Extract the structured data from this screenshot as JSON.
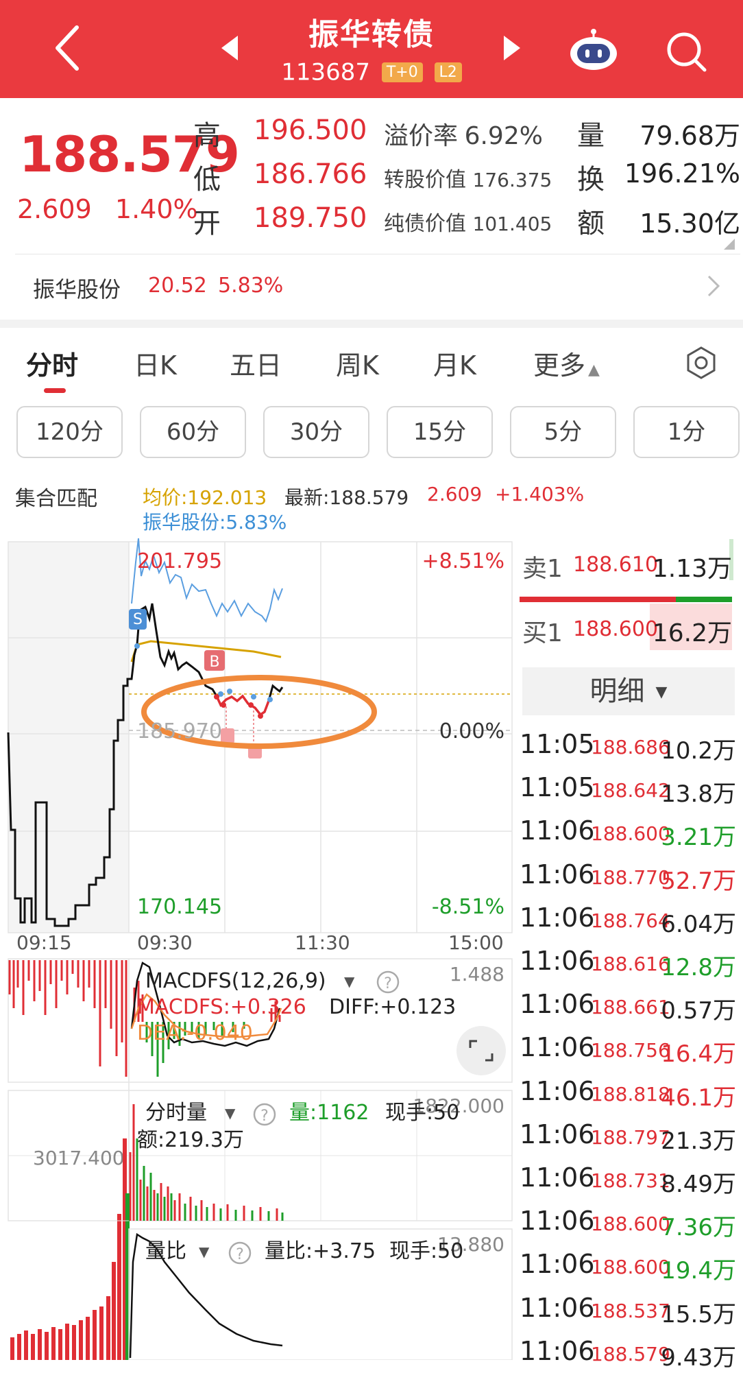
{
  "header": {
    "title": "振华转债",
    "code": "113687",
    "tags": [
      "T+0",
      "L2"
    ]
  },
  "quote": {
    "price": "188.579",
    "change": "2.609",
    "change_pct": "1.40%",
    "labels": {
      "high": "高",
      "low": "低",
      "open": "开"
    },
    "high": "196.500",
    "low": "186.766",
    "open": "189.750",
    "premium_label": "溢价率",
    "premium": "6.92%",
    "conv_value_label": "转股价值",
    "conv_value": "176.375",
    "bond_value_label": "纯债价值",
    "bond_value": "101.405",
    "right_labels": {
      "volume": "量",
      "turnover": "换",
      "amount": "额"
    },
    "volume": "79.68万",
    "turnover": "196.21%",
    "amount": "15.30亿"
  },
  "stock": {
    "name": "振华股份",
    "price": "20.52",
    "pct": "5.83%"
  },
  "tabs": [
    "分时",
    "日K",
    "五日",
    "周K",
    "月K",
    "更多"
  ],
  "periods": [
    "120分",
    "60分",
    "30分",
    "15分",
    "5分",
    "1分"
  ],
  "infobar": {
    "auction": "集合匹配",
    "avg": "均价:192.013",
    "latest": "最新:188.579",
    "chg": "2.609",
    "pct": "+1.403%",
    "stock": "振华股份:5.83%"
  },
  "main_chart": {
    "high_price": "201.795",
    "high_pct": "+8.51%",
    "base_price": "185.970",
    "base_pct": "0.00%",
    "low_price": "170.145",
    "low_pct": "-8.51%",
    "time_labels": [
      "09:15",
      "09:30",
      "11:30",
      "15:00"
    ],
    "marker_s": "S",
    "marker_b": "B"
  },
  "macd": {
    "title": "MACDFS(12,26,9)",
    "max": "1.488",
    "macdfs": "MACDFS:+0.326",
    "diff": "DIFF:+0.123",
    "dea": "DEA:-0.040"
  },
  "volume_panel": {
    "title": "分时量",
    "vol": "量:1162",
    "hand": "现手:50",
    "max": "1822.000",
    "amount": "额:219.3万",
    "left_val": "3017.400"
  },
  "ratio_panel": {
    "title": "量比",
    "ratio": "量比:+3.75",
    "hand": "现手:50",
    "max": "13.880"
  },
  "orderbook": {
    "sell_label": "卖1",
    "sell_price": "188.610",
    "sell_qty": "1.13万",
    "buy_label": "买1",
    "buy_price": "188.600",
    "buy_qty": "16.2万",
    "detail": "明细"
  },
  "trades": [
    {
      "time": "11:05",
      "price": "188.686",
      "qty": "10.2万",
      "dir": "neutral"
    },
    {
      "time": "11:05",
      "price": "188.642",
      "qty": "13.8万",
      "dir": "neutral"
    },
    {
      "time": "11:06",
      "price": "188.600",
      "qty": "3.21万",
      "dir": "sell"
    },
    {
      "time": "11:06",
      "price": "188.770",
      "qty": "52.7万",
      "dir": "buy"
    },
    {
      "time": "11:06",
      "price": "188.764",
      "qty": "6.04万",
      "dir": "neutral"
    },
    {
      "time": "11:06",
      "price": "188.616",
      "qty": "12.8万",
      "dir": "sell"
    },
    {
      "time": "11:06",
      "price": "188.661",
      "qty": "0.57万",
      "dir": "neutral"
    },
    {
      "time": "11:06",
      "price": "188.756",
      "qty": "16.4万",
      "dir": "buy"
    },
    {
      "time": "11:06",
      "price": "188.818",
      "qty": "46.1万",
      "dir": "buy"
    },
    {
      "time": "11:06",
      "price": "188.797",
      "qty": "21.3万",
      "dir": "neutral"
    },
    {
      "time": "11:06",
      "price": "188.731",
      "qty": "8.49万",
      "dir": "neutral"
    },
    {
      "time": "11:06",
      "price": "188.600",
      "qty": "7.36万",
      "dir": "sell"
    },
    {
      "time": "11:06",
      "price": "188.600",
      "qty": "19.4万",
      "dir": "sell"
    },
    {
      "time": "11:06",
      "price": "188.537",
      "qty": "15.5万",
      "dir": "neutral"
    },
    {
      "time": "11:06",
      "price": "188.579",
      "qty": "9.43万",
      "dir": "neutral"
    }
  ],
  "colors": {
    "up": "#e02e35",
    "down": "#1e9e2a",
    "neutral": "#222222",
    "brand": "#ea3a3f",
    "highlight": "#f08a3c"
  }
}
